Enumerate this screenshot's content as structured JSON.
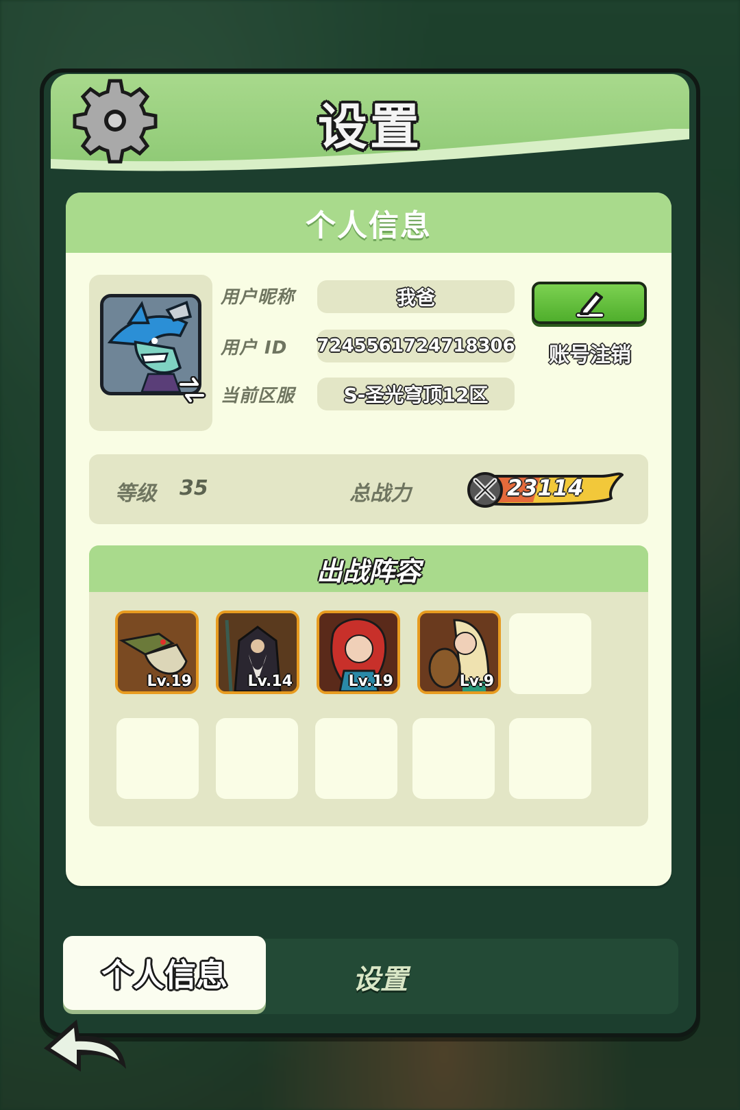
{
  "dialog": {
    "title": "设置",
    "card_title": "个人信息"
  },
  "profile": {
    "nickname_label": "用户昵称",
    "nickname_value": "我爸",
    "id_label": "用户  ID",
    "id_value": "7245561724718306",
    "server_label": "当前区服",
    "server_value": "S-圣光穹顶12区",
    "account_cancel_label": "账号注销"
  },
  "stats": {
    "level_label": "等级",
    "level_value": "35",
    "power_label": "总战力",
    "power_value": "23114"
  },
  "lineup": {
    "title": "出战阵容",
    "heroes": [
      {
        "name": "crocodile-warrior",
        "level": "Lv.19",
        "color": "#6b7a3a"
      },
      {
        "name": "dark-sage",
        "level": "Lv.14",
        "color": "#3b3548"
      },
      {
        "name": "red-haired-girl",
        "level": "Lv.19",
        "color": "#b23a2a"
      },
      {
        "name": "bard-girl",
        "level": "Lv.9",
        "color": "#c9a45a"
      }
    ],
    "empty_slots": 6
  },
  "tabs": {
    "active": "个人信息",
    "inactive": "设置"
  },
  "icons": {
    "gear": "gear-icon",
    "edit": "pencil-icon",
    "swap": "swap-icon",
    "back": "back-arrow-icon",
    "power": "crossed-swords-icon"
  },
  "colors": {
    "header_green": "#a8d98c",
    "card_bg": "#f9fde4",
    "panel_bg": "#e3e6c6",
    "button_green": "#4fae2c",
    "hero_border": "#e79b20"
  }
}
